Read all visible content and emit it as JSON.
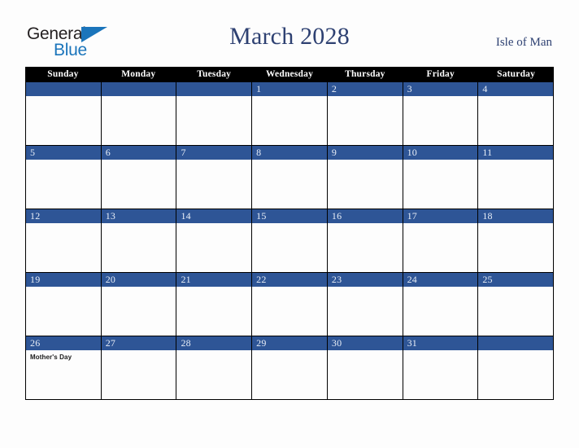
{
  "brand": {
    "name_part1": "General",
    "name_part2": "Blue",
    "flag_icon": "flag-triangle-icon"
  },
  "header": {
    "title": "March 2028",
    "region": "Isle of Man"
  },
  "calendar": {
    "weekday_headers": [
      "Sunday",
      "Monday",
      "Tuesday",
      "Wednesday",
      "Thursday",
      "Friday",
      "Saturday"
    ],
    "weeks": [
      [
        {
          "day": ""
        },
        {
          "day": ""
        },
        {
          "day": ""
        },
        {
          "day": "1"
        },
        {
          "day": "2"
        },
        {
          "day": "3"
        },
        {
          "day": "4"
        }
      ],
      [
        {
          "day": "5"
        },
        {
          "day": "6"
        },
        {
          "day": "7"
        },
        {
          "day": "8"
        },
        {
          "day": "9"
        },
        {
          "day": "10"
        },
        {
          "day": "11"
        }
      ],
      [
        {
          "day": "12"
        },
        {
          "day": "13"
        },
        {
          "day": "14"
        },
        {
          "day": "15"
        },
        {
          "day": "16"
        },
        {
          "day": "17"
        },
        {
          "day": "18"
        }
      ],
      [
        {
          "day": "19"
        },
        {
          "day": "20"
        },
        {
          "day": "21"
        },
        {
          "day": "22"
        },
        {
          "day": "23"
        },
        {
          "day": "24"
        },
        {
          "day": "25"
        }
      ],
      [
        {
          "day": "26",
          "event": "Mother's Day"
        },
        {
          "day": "27"
        },
        {
          "day": "28"
        },
        {
          "day": "29"
        },
        {
          "day": "30"
        },
        {
          "day": "31"
        },
        {
          "day": ""
        }
      ]
    ]
  },
  "colors": {
    "day_bar": "#2e5596",
    "header_bar": "#000000",
    "title": "#2e4172",
    "brand_blue": "#1b75bb",
    "page_background": "#fdfdfd"
  }
}
